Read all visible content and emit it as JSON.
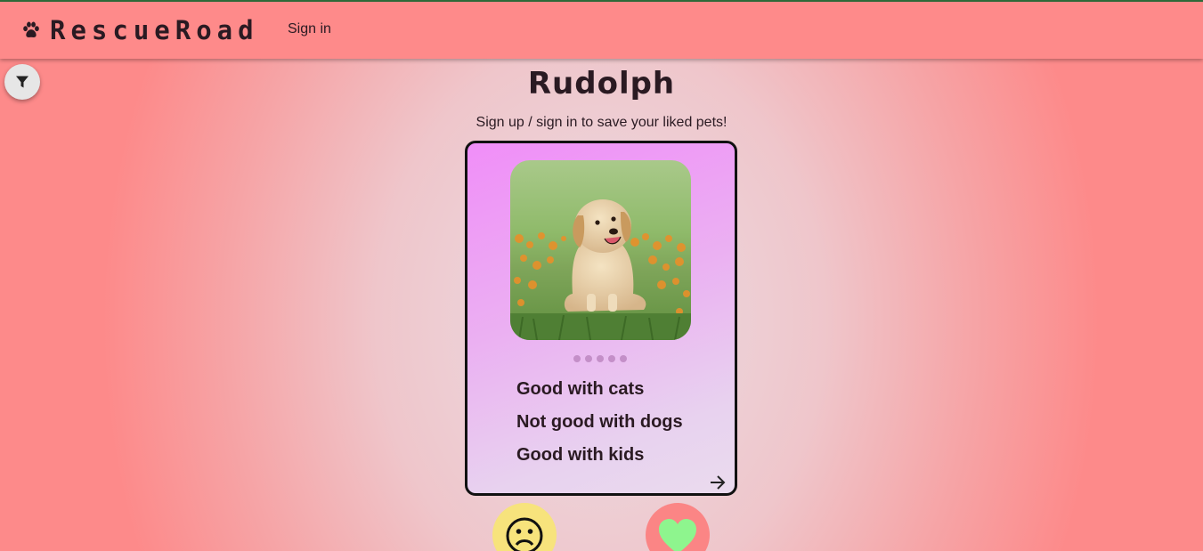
{
  "app": {
    "brand": "RescueRoad",
    "signin_label": "Sign in"
  },
  "pet": {
    "name": "Rudolph",
    "photo_subject": "golden retriever puppy sitting in grass with orange flowers",
    "traits": [
      "Good with cats",
      "Not good with dogs",
      "Good with kids"
    ],
    "photo_count": 5,
    "active_photo": 1
  },
  "prompt": "Sign up / sign in to save your liked pets!",
  "icons": {
    "brand": "paw-icon",
    "filter": "filter-icon",
    "next": "arrow-right-icon",
    "dislike": "frown-face-icon",
    "like": "heart-icon"
  },
  "colors": {
    "navbar": "#fe8a8a",
    "card_gradient_start": "#f08ef8",
    "dislike_button": "#f7e37c",
    "like_button": "#fb8585",
    "heart": "#8ef58e"
  }
}
